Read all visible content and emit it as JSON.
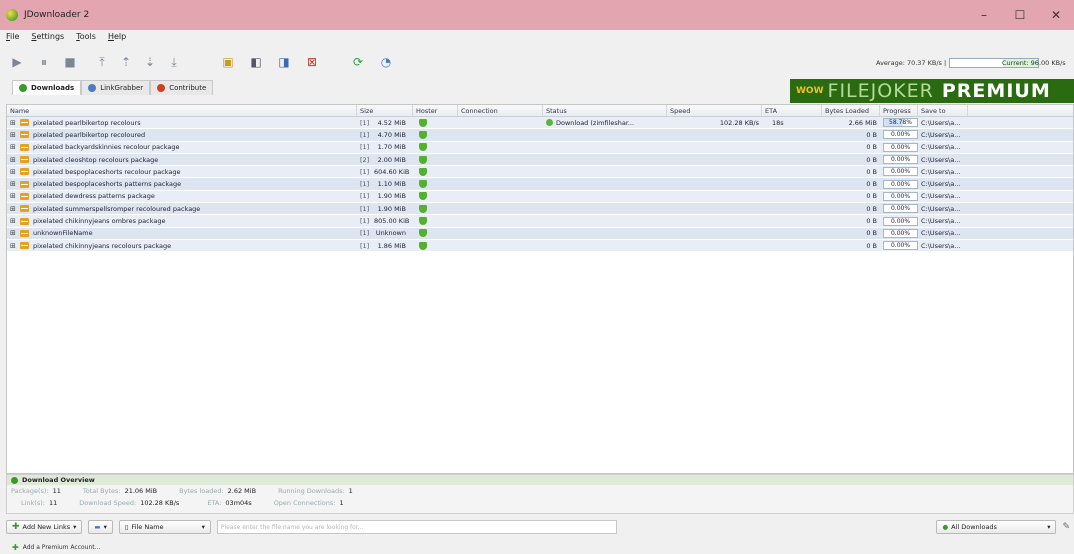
{
  "window": {
    "title": "JDownloader 2",
    "minimize": "–",
    "maximize": "☐",
    "close": "✕"
  },
  "menu": [
    "File",
    "Settings",
    "Tools",
    "Help"
  ],
  "toolbar": {
    "average_label": "Average: 70.37 KB/s |",
    "current_label": "Current: 96.00 KB/s"
  },
  "tabs": [
    {
      "label": "Downloads",
      "icon": "download-icon",
      "color": "#3a9a2a"
    },
    {
      "label": "LinkGrabber",
      "icon": "linkgrabber-icon",
      "color": "#4a7ac0"
    },
    {
      "label": "Contribute",
      "icon": "heart-icon",
      "color": "#d04020"
    }
  ],
  "banner": {
    "part1": "WOW",
    "part2": "FILEJOKER",
    "part3": "PREMIUM"
  },
  "columns": [
    "Name",
    "Size",
    "Hoster",
    "Connection",
    "Status",
    "Speed",
    "ETA",
    "Bytes Loaded",
    "Progress",
    "Save to"
  ],
  "rows": [
    {
      "name": "pixelated pearlbikertop recolours",
      "count": "[1]",
      "size": "4.52 MiB",
      "status": "Download (zimfileshar...",
      "speed": "102.28 KB/s",
      "eta": "18s",
      "bytes": "2.66 MiB",
      "progress": "58.78%",
      "progress_value": 58.78,
      "save": "C:\\Users\\a..."
    },
    {
      "name": "pixelated pearlbikertop recoloured",
      "count": "[1]",
      "size": "4.70 MiB",
      "status": "",
      "speed": "",
      "eta": "",
      "bytes": "0 B",
      "progress": "0.00%",
      "progress_value": 0,
      "save": "C:\\Users\\a..."
    },
    {
      "name": "pixelated backyardskinnies recolour package",
      "count": "[1]",
      "size": "1.70 MiB",
      "status": "",
      "speed": "",
      "eta": "",
      "bytes": "0 B",
      "progress": "0.00%",
      "progress_value": 0,
      "save": "C:\\Users\\a..."
    },
    {
      "name": "pixelated cleoshtop recolours package",
      "count": "[2]",
      "size": "2.00 MiB",
      "status": "",
      "speed": "",
      "eta": "",
      "bytes": "0 B",
      "progress": "0.00%",
      "progress_value": 0,
      "save": "C:\\Users\\a..."
    },
    {
      "name": "pixelated bespoplaceshorts recolour package",
      "count": "[1]",
      "size": "604.60 KiB",
      "status": "",
      "speed": "",
      "eta": "",
      "bytes": "0 B",
      "progress": "0.00%",
      "progress_value": 0,
      "save": "C:\\Users\\a..."
    },
    {
      "name": "pixelated bespoplaceshorts patterns package",
      "count": "[1]",
      "size": "1.10 MiB",
      "status": "",
      "speed": "",
      "eta": "",
      "bytes": "0 B",
      "progress": "0.00%",
      "progress_value": 0,
      "save": "C:\\Users\\a..."
    },
    {
      "name": "pixelated dewdress patterns package",
      "count": "[1]",
      "size": "1.90 MiB",
      "status": "",
      "speed": "",
      "eta": "",
      "bytes": "0 B",
      "progress": "0.00%",
      "progress_value": 0,
      "save": "C:\\Users\\a..."
    },
    {
      "name": "pixelated summerspellsromper recoloured package",
      "count": "[1]",
      "size": "1.90 MiB",
      "status": "",
      "speed": "",
      "eta": "",
      "bytes": "0 B",
      "progress": "0.00%",
      "progress_value": 0,
      "save": "C:\\Users\\a..."
    },
    {
      "name": "pixelated chikinnyjeans ombres package",
      "count": "[1]",
      "size": "805.00 KiB",
      "status": "",
      "speed": "",
      "eta": "",
      "bytes": "0 B",
      "progress": "0.00%",
      "progress_value": 0,
      "save": "C:\\Users\\a..."
    },
    {
      "name": "unknownFileName",
      "count": "[1]",
      "size": "Unknown",
      "status": "",
      "speed": "",
      "eta": "",
      "bytes": "0 B",
      "progress": "0.00%",
      "progress_value": 0,
      "save": "C:\\Users\\a..."
    },
    {
      "name": "pixelated chikinnyjeans recolours package",
      "count": "[1]",
      "size": "1.86 MiB",
      "status": "",
      "speed": "",
      "eta": "",
      "bytes": "0 B",
      "progress": "0.00%",
      "progress_value": 0,
      "save": "C:\\Users\\a..."
    }
  ],
  "overview": {
    "title": "Download Overview",
    "packages_label": "Package(s):",
    "packages": "11",
    "total_bytes_label": "Total Bytes:",
    "total_bytes": "21.06 MiB",
    "bytes_loaded_label": "Bytes loaded:",
    "bytes_loaded": "2.62 MiB",
    "running_label": "Running Downloads:",
    "running": "1",
    "links_label": "Link(s):",
    "links": "11",
    "speed_label": "Download Speed:",
    "speed": "102.28 KB/s",
    "eta_label": "ETA:",
    "eta": "03m04s",
    "conn_label": "Open Connections:",
    "conn": "1"
  },
  "bottom": {
    "add_links": "Add New Links",
    "file_name": "File Name",
    "search_placeholder": "Please enter the file name you are looking for...",
    "all_downloads": "All Downloads",
    "premium": "Add a Premium Account..."
  }
}
